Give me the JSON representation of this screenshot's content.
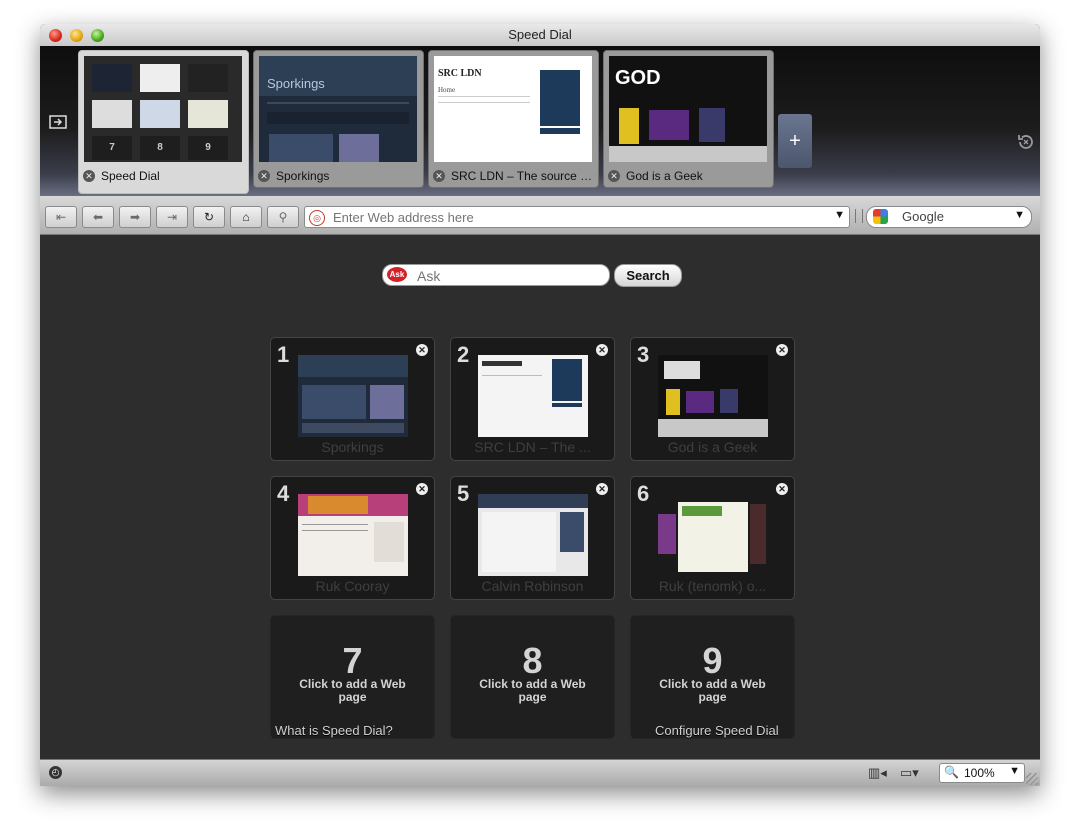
{
  "window": {
    "title": "Speed Dial"
  },
  "tabs": [
    {
      "label": "Speed Dial",
      "active": true
    },
    {
      "label": "Sporkings",
      "active": false
    },
    {
      "label": "SRC LDN – The source o...",
      "active": false
    },
    {
      "label": "God is a Geek",
      "active": false
    }
  ],
  "thumb_text": {
    "sporkings": "Sporkings",
    "srcldn": "SRC LDN",
    "srcldn_home": "Home",
    "god": "GOD"
  },
  "toolbar": {
    "address_placeholder": "Enter Web address here",
    "search_engine": "Google"
  },
  "ask": {
    "placeholder": "Ask",
    "button": "Search",
    "logo": "Ask"
  },
  "dials": [
    {
      "num": "1",
      "title": "Sporkings"
    },
    {
      "num": "2",
      "title": "SRC LDN – The ..."
    },
    {
      "num": "3",
      "title": "God is a Geek"
    },
    {
      "num": "4",
      "title": "Ruk Cooray"
    },
    {
      "num": "5",
      "title": "Calvin Robinson"
    },
    {
      "num": "6",
      "title": "Ruk (tenomk) o..."
    }
  ],
  "empty_dials": [
    {
      "num": "7",
      "hint": "Click to add a Web page"
    },
    {
      "num": "8",
      "hint": "Click to add a Web page"
    },
    {
      "num": "9",
      "hint": "Click to add a Web page"
    }
  ],
  "links": {
    "what_is": "What is Speed Dial?",
    "configure": "Configure Speed Dial"
  },
  "statusbar": {
    "zoom": "100%"
  },
  "icons": {
    "panel": "panel-toggle-icon",
    "trash": "closed-tabs-trash-icon",
    "new_tab": "new-tab-icon",
    "rewind": "rewind-icon",
    "back": "back-icon",
    "forward": "forward-icon",
    "fast_forward": "fast-forward-icon",
    "reload": "reload-icon",
    "home": "home-icon",
    "wand": "wand-icon"
  }
}
